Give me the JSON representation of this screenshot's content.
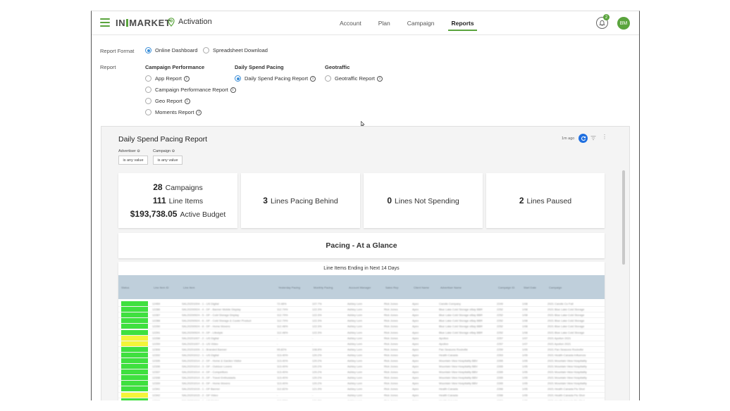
{
  "header": {
    "brand_left": "IN",
    "brand_right": "MARKET",
    "app_name": "Activation",
    "tabs": [
      {
        "label": "Account",
        "active": false
      },
      {
        "label": "Plan",
        "active": false
      },
      {
        "label": "Campaign",
        "active": false
      },
      {
        "label": "Reports",
        "active": true
      }
    ],
    "notification_count": "2",
    "avatar_initials": "BM",
    "accent_color": "#5aa43d"
  },
  "form": {
    "format_label": "Report Format",
    "format_options": [
      {
        "label": "Online Dashboard",
        "checked": true
      },
      {
        "label": "Spreadsheet Download",
        "checked": false
      }
    ],
    "report_label": "Report",
    "groups": [
      {
        "title": "Campaign Performance",
        "options": [
          {
            "label": "App Report",
            "checked": false
          },
          {
            "label": "Campaign Performance Report",
            "checked": false
          },
          {
            "label": "Geo Report",
            "checked": false
          },
          {
            "label": "Moments Report",
            "checked": false
          }
        ]
      },
      {
        "title": "Daily Spend Pacing",
        "options": [
          {
            "label": "Daily Spend Pacing Report",
            "checked": true
          }
        ]
      },
      {
        "title": "Geotraffic",
        "options": [
          {
            "label": "Geotraffic Report",
            "checked": false
          }
        ]
      }
    ],
    "info_glyph": "i"
  },
  "dashboard": {
    "title": "Daily Spend Pacing Report",
    "updated": "1m ago",
    "more_glyph": "⋮",
    "filters": [
      {
        "label": "Advertiser",
        "value": "is any value"
      },
      {
        "label": "Campaign",
        "value": "is any value"
      }
    ],
    "summary": {
      "campaigns_value": "28",
      "campaigns_label": "Campaigns",
      "line_items_value": "111",
      "line_items_label": "Line Items",
      "budget_value": "$193,738.05",
      "budget_label": "Active Budget"
    },
    "kpis": [
      {
        "value": "3",
        "label": "Lines Pacing Behind"
      },
      {
        "value": "0",
        "label": "Lines Not Spending"
      },
      {
        "value": "2",
        "label": "Lines Paused"
      }
    ],
    "glance_title": "Pacing - At a Glance",
    "table_caption": "Line Items Ending in Next 14 Days",
    "status_colors": {
      "on_track": "#3fe03f",
      "warning": "#f4f43a"
    },
    "table_columns": [
      "Status",
      "Line Item ID",
      "Line Item",
      "Yesterday Pacing",
      "Monthly Pacing",
      "Account Manager",
      "Sales Rep",
      "Client Name",
      "Advertiser Name",
      "Campaign ID",
      "Start Date",
      "Campaign"
    ],
    "table_rows": [
      {
        "status": "on_track",
        "cells": [
          "12459",
          "SAL20201004 - 1 - US Digital",
          "72.48%",
          "107.7%",
          "Ashley Lem",
          "Rick Jones",
          "Apex",
          "Candle Company",
          "2249",
          "1/08",
          "2021 Candle Co Fall"
        ]
      },
      {
        "status": "on_track",
        "cells": [
          "12286",
          "SAL20200924 - 4 - DF - Banner Mobile Display",
          "112.79%",
          "122.3%",
          "Ashley Lem",
          "Rick Jones",
          "Apex",
          "Blue Lake Cold Storage eBay BBR",
          "2252",
          "1/08",
          "2021 Blue Lake Cold Storage"
        ]
      },
      {
        "status": "on_track",
        "cells": [
          "12287",
          "SAL20200924 - 5 - DF - Cold Storage Display",
          "112.79%",
          "122.3%",
          "Ashley Lem",
          "Rick Jones",
          "Apex",
          "Blue Lake Cold Storage eBay BBR",
          "2252",
          "1/08",
          "2021 Blue Lake Cold Storage"
        ]
      },
      {
        "status": "on_track",
        "cells": [
          "12288",
          "SAL20200924 - 6 - DF - Cold Storage & Cooler Product",
          "112.79%",
          "122.3%",
          "Ashley Lem",
          "Rick Jones",
          "Apex",
          "Blue Lake Cold Storage eBay BBR",
          "2252",
          "1/08",
          "2021 Blue Lake Cold Storage"
        ]
      },
      {
        "status": "on_track",
        "cells": [
          "12290",
          "SAL20200924 - 8 - DF - Home Movers",
          "112.48%",
          "122.3%",
          "Ashley Lem",
          "Rick Jones",
          "Apex",
          "Blue Lake Cold Storage eBay BBR",
          "2252",
          "1/08",
          "2021 Blue Lake Cold Storage"
        ]
      },
      {
        "status": "on_track",
        "cells": [
          "12291",
          "SAL20200924 - 9 - DF - Lifestyle",
          "112.48%",
          "122.3%",
          "Ashley Lem",
          "Rick Jones",
          "Apex",
          "Blue Lake Cold Storage eBay BBR",
          "2252",
          "1/08",
          "2021 Blue Lake Cold Storage"
        ]
      },
      {
        "status": "warning",
        "cells": [
          "12298",
          "SAL20201007 - 2 - US Digital",
          "-",
          "-",
          "Ashley Lem",
          "Rick Jones",
          "Apex",
          "Apollon",
          "2257",
          "1/07",
          "2021 Apollon 2021"
        ]
      },
      {
        "status": "warning",
        "cells": [
          "12299",
          "SAL20201007 - 3 - US Video",
          "-",
          "-",
          "Ashley Lem",
          "Rick Jones",
          "Apex",
          "Apollon",
          "2257",
          "1/07",
          "2021 Apollon 2021"
        ]
      },
      {
        "status": "on_track",
        "cells": [
          "12306",
          "SAL20201009 - 1 - Branded Banner",
          "95.82%",
          "108.8%",
          "Ashley Lem",
          "Rick Jones",
          "Apex",
          "Pan Seasons Rockville",
          "2259",
          "1/05",
          "2021 Pan Seasons Rockville"
        ]
      },
      {
        "status": "on_track",
        "cells": [
          "12332",
          "SAL20201012 - 1 - US Digital",
          "113.40%",
          "120.2%",
          "Ashley Lem",
          "Rick Jones",
          "Apex",
          "Health Canada",
          "2263",
          "1/05",
          "2021 Health Canada Influenza"
        ]
      },
      {
        "status": "on_track",
        "cells": [
          "12335",
          "SAL20201014 - 2 - DF - Home & Garden Visitor",
          "113.40%",
          "120.2%",
          "Ashley Lem",
          "Rick Jones",
          "Apex",
          "Mountain View Hospitality BBV",
          "2265",
          "1/05",
          "2021 Mountain View Hospitality"
        ]
      },
      {
        "status": "on_track",
        "cells": [
          "12336",
          "SAL20201014 - 3 - DF - Outdoor Lovers",
          "113.40%",
          "120.2%",
          "Ashley Lem",
          "Rick Jones",
          "Apex",
          "Mountain View Hospitality BBV",
          "2265",
          "1/05",
          "2021 Mountain View Hospitality"
        ]
      },
      {
        "status": "on_track",
        "cells": [
          "12337",
          "SAL20201014 - 4 - DF - Competitors",
          "113.40%",
          "120.2%",
          "Ashley Lem",
          "Rick Jones",
          "Apex",
          "Mountain View Hospitality BBV",
          "2265",
          "1/05",
          "2021 Mountain View Hospitality"
        ]
      },
      {
        "status": "on_track",
        "cells": [
          "12338",
          "SAL20201014 - 5 - DF - Travel Enthusiasts",
          "113.40%",
          "120.2%",
          "Ashley Lem",
          "Rick Jones",
          "Apex",
          "Mountain View Hospitality BBV",
          "2265",
          "1/05",
          "2021 Mountain View Hospitality"
        ]
      },
      {
        "status": "on_track",
        "cells": [
          "12339",
          "SAL20201014 - 6 - DF - Home Movers",
          "113.40%",
          "120.2%",
          "Ashley Lem",
          "Rick Jones",
          "Apex",
          "Mountain View Hospitality BBV",
          "2265",
          "1/05",
          "2021 Mountain View Hospitality"
        ]
      },
      {
        "status": "on_track",
        "cells": [
          "12341",
          "SAL20201015 - 1 - DF Banner",
          "112.82%",
          "121.9%",
          "Ashley Lem",
          "Rick Jones",
          "Apex",
          "Health Canada",
          "2266",
          "1/05",
          "2021 Health Canada Flu Shot"
        ]
      },
      {
        "status": "warning",
        "cells": [
          "12342",
          "SAL20201015 - 2 - DF Video",
          "-",
          "-",
          "Ashley Lem",
          "Rick Jones",
          "Apex",
          "Health Canada",
          "2266",
          "1/05",
          "2021 Health Canada Flu Shot"
        ]
      },
      {
        "status": "on_track",
        "cells": [
          "12344",
          "SAL20201016 - 1 - US Digital",
          "112.82%",
          "121.9%",
          "Ashley Lem",
          "Rick Jones",
          "Apex",
          "Health Canada",
          "2267",
          "1/05",
          "2021 Health Canada Flu Shot"
        ]
      }
    ]
  }
}
